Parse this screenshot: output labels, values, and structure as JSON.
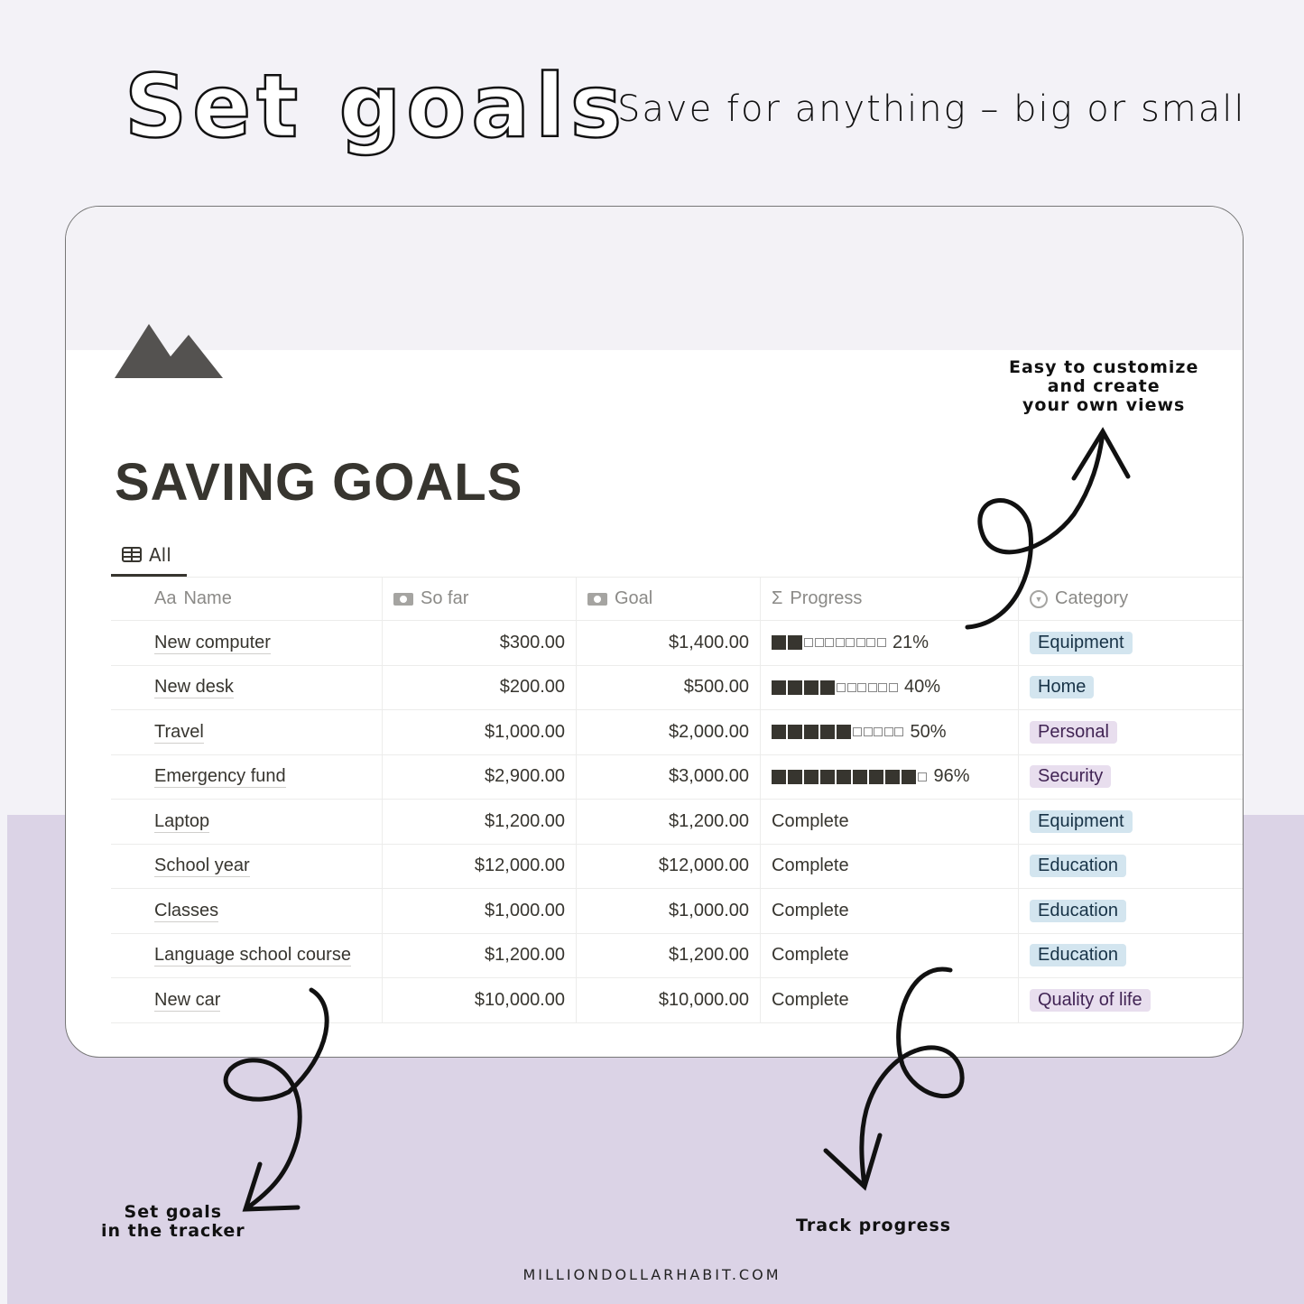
{
  "header": {
    "title": "Set goals",
    "subtitle": "Save for anything – big or small"
  },
  "page": {
    "title": "SAVING GOALS",
    "icon": "mountain-icon",
    "view_tab": "All"
  },
  "table": {
    "columns": [
      {
        "label": "Name",
        "icon": "Aa"
      },
      {
        "label": "So far",
        "icon": "money-icon"
      },
      {
        "label": "Goal",
        "icon": "money-icon"
      },
      {
        "label": "Progress",
        "icon": "Σ"
      },
      {
        "label": "Category",
        "icon": "select-icon"
      }
    ],
    "rows": [
      {
        "name": "New computer",
        "so_far": "$300.00",
        "goal": "$1,400.00",
        "progress": "21%",
        "filled": 2,
        "empty": 8,
        "category": "Equipment",
        "color": "blue"
      },
      {
        "name": "New desk",
        "so_far": "$200.00",
        "goal": "$500.00",
        "progress": "40%",
        "filled": 4,
        "empty": 6,
        "category": "Home",
        "color": "blue"
      },
      {
        "name": "Travel",
        "so_far": "$1,000.00",
        "goal": "$2,000.00",
        "progress": "50%",
        "filled": 5,
        "empty": 5,
        "category": "Personal",
        "color": "purple"
      },
      {
        "name": "Emergency fund",
        "so_far": "$2,900.00",
        "goal": "$3,000.00",
        "progress": "96%",
        "filled": 9,
        "empty": 1,
        "category": "Security",
        "color": "purple"
      },
      {
        "name": "Laptop",
        "so_far": "$1,200.00",
        "goal": "$1,200.00",
        "progress": "Complete",
        "category": "Equipment",
        "color": "blue"
      },
      {
        "name": "School year",
        "so_far": "$12,000.00",
        "goal": "$12,000.00",
        "progress": "Complete",
        "category": "Education",
        "color": "blue"
      },
      {
        "name": "Classes",
        "so_far": "$1,000.00",
        "goal": "$1,000.00",
        "progress": "Complete",
        "category": "Education",
        "color": "blue"
      },
      {
        "name": "Language school course",
        "so_far": "$1,200.00",
        "goal": "$1,200.00",
        "progress": "Complete",
        "category": "Education",
        "color": "blue"
      },
      {
        "name": "New car",
        "so_far": "$10,000.00",
        "goal": "$10,000.00",
        "progress": "Complete",
        "category": "Quality of life",
        "color": "purple"
      }
    ]
  },
  "tag_colors": {
    "blue": {
      "bg": "#d3e5ef",
      "fg": "#183347"
    },
    "purple": {
      "bg": "#e8deee",
      "fg": "#412454"
    }
  },
  "notes": {
    "views": "Easy to customize\nand create\nyour own views",
    "set_goals": "Set goals\nin the tracker",
    "track": "Track progress"
  },
  "footer": "MILLIONDOLLARHABIT.COM"
}
